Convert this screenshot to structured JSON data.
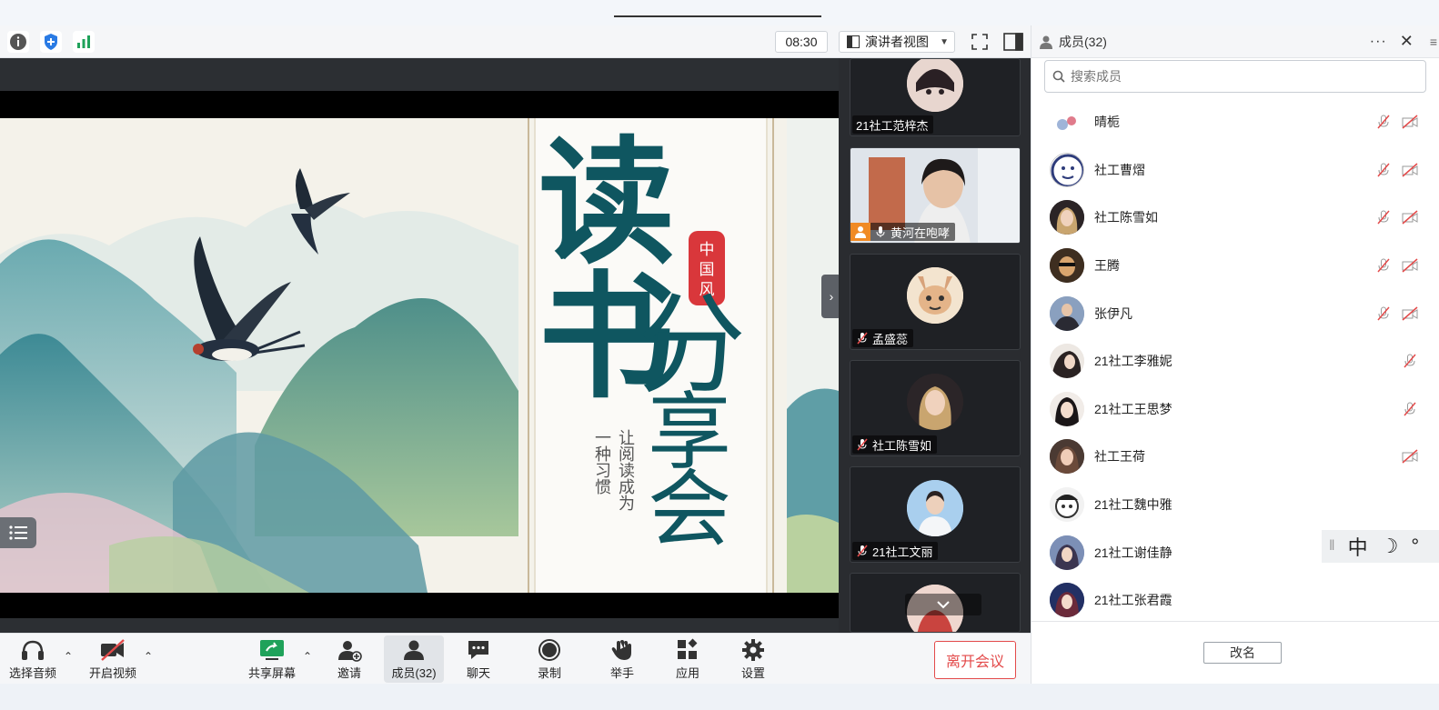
{
  "toolbar": {
    "timer": "08:30",
    "view_mode": "演讲者视图",
    "icons": [
      "info-icon",
      "shield-icon",
      "signal-icon",
      "fullscreen-icon",
      "sidebar-toggle-icon"
    ]
  },
  "slide": {
    "title_chars": [
      "读",
      "书",
      "分",
      "享",
      "会"
    ],
    "seal_text": [
      "中",
      "国",
      "风"
    ],
    "subtitle_col1": "让阅读成为",
    "subtitle_col2": "一种习惯"
  },
  "video_tiles": [
    {
      "name": "21社工范梓杰",
      "mic": "none"
    },
    {
      "name": "黄河在咆哮",
      "mic": "on"
    },
    {
      "name": "孟盛蕊",
      "mic": "off"
    },
    {
      "name": "社工陈雪如",
      "mic": "off"
    },
    {
      "name": "21社工文丽",
      "mic": "off"
    }
  ],
  "panel": {
    "title": "成员(32)",
    "more": "···",
    "close": "✕",
    "search_placeholder": "搜索成员",
    "members": [
      {
        "name": "晴栀",
        "mic_off": true,
        "cam_off": true
      },
      {
        "name": "社工曹熠",
        "mic_off": true,
        "cam_off": true
      },
      {
        "name": "社工陈雪如",
        "mic_off": true,
        "cam_off": true
      },
      {
        "name": "王腾",
        "mic_off": true,
        "cam_off": true
      },
      {
        "name": "张伊凡",
        "mic_off": true,
        "cam_off": true
      },
      {
        "name": "21社工李雅妮",
        "mic_off": true,
        "cam_off": false
      },
      {
        "name": "21社工王思梦",
        "mic_off": true,
        "cam_off": false
      },
      {
        "name": "社工王荷",
        "mic_off": false,
        "cam_off": true
      },
      {
        "name": "21社工魏中雅",
        "mic_off": false,
        "cam_off": false
      },
      {
        "name": "21社工谢佳静",
        "mic_off": false,
        "cam_off": false
      },
      {
        "name": "21社工张君霞",
        "mic_off": false,
        "cam_off": false
      }
    ],
    "rename_label": "改名"
  },
  "ime": {
    "lang": "中",
    "moon": "☽",
    "degree": "°"
  },
  "bottombar": {
    "audio": "选择音频",
    "video": "开启视频",
    "share": "共享屏幕",
    "invite": "邀请",
    "members": "成员(32)",
    "chat": "聊天",
    "record": "录制",
    "raise_hand": "举手",
    "apps": "应用",
    "settings": "设置",
    "leave": "离开会议"
  },
  "colors": {
    "accent": "#2a8cff",
    "leave": "#e34a4a",
    "slide_teal": "#0f5660",
    "seal_red": "#d9373b",
    "share_green": "#1fa25a"
  }
}
